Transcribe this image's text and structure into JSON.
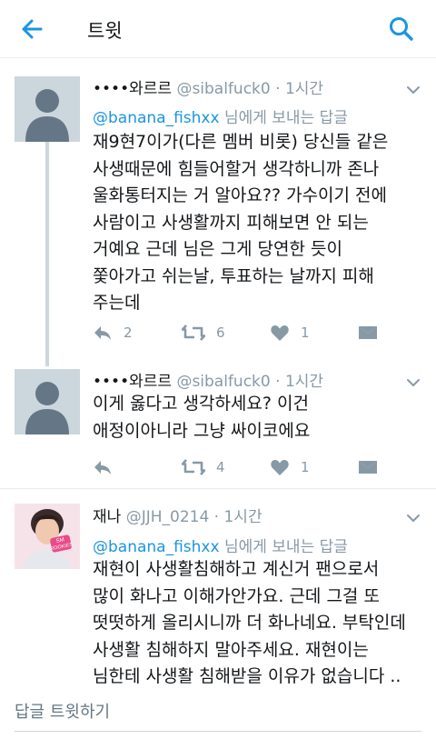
{
  "header": {
    "title": "트윗",
    "back_icon": "arrow-left-icon",
    "search_icon": "search-icon",
    "accent_color": "#1b95e0"
  },
  "tweets": [
    {
      "name": "••••와르르",
      "handle": "@sibalfuck0",
      "time": "1시간",
      "reply_to": "@banana_fishxx",
      "reply_suffix": "님에게 보내는 답글",
      "text": "재9현7이가(다른 멤버 비롯) 당신들 같은\n사생때문에 힘들어할거 생각하니까 존나\n울화통터지는 거 알아요?? 가수이기 전에\n사람이고 사생활까지 피해보면 안 되는\n거예요 근데 님은 그게 당연한 듯이\n쫓아가고 쉬는날, 투표하는 날까지 피해\n주는데",
      "replies": "2",
      "retweets": "6",
      "likes": "1"
    },
    {
      "name": "••••와르르",
      "handle": "@sibalfuck0",
      "time": "1시간",
      "text": "이게 옳다고 생각하세요? 이건\n애정이아니라 그냥 싸이코에요",
      "replies": "",
      "retweets": "4",
      "likes": "1"
    },
    {
      "name": "재나",
      "handle": "@JJH_0214",
      "time": "1시간",
      "reply_to": "@banana_fishxx",
      "reply_suffix": "님에게 보내는 답글",
      "avatar_text": "SM ROOKIES",
      "text": "재현이 사생활침해하고 계신거 팬으로서\n많이 화나고 이해가안가요. 근데 그걸 또\n떳떳하게 올리시니까 더 화나네요. 부탁인데\n사생활 침해하지 말아주세요. 재현이는\n님한테 사생활 침해받을 이유가 없습니다 .."
    }
  ],
  "separator": "·",
  "compose": {
    "placeholder": "답글 트윗하기"
  }
}
